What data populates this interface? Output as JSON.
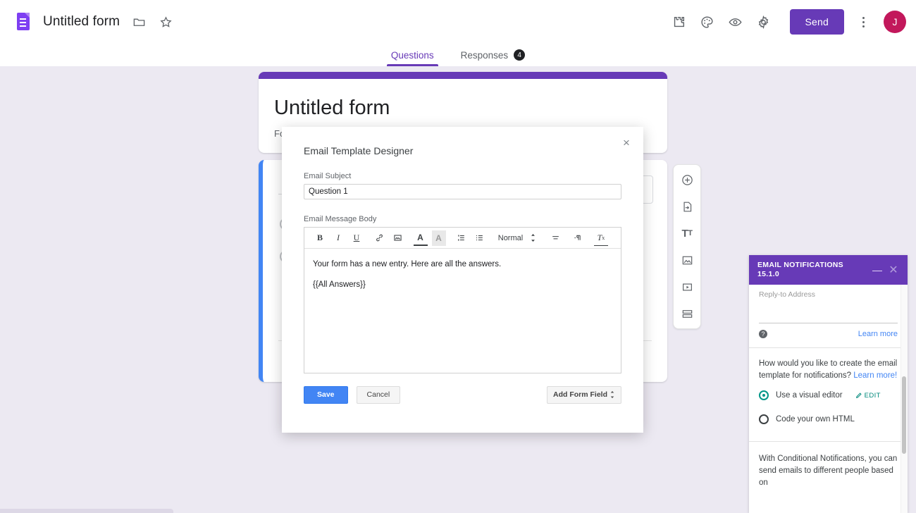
{
  "topbar": {
    "doc_title": "Untitled form",
    "icons": {
      "logo": "google-forms-logo",
      "folder": "move-to-folder-icon",
      "star": "star-icon",
      "addons": "addons-puzzle-icon",
      "theme": "theme-palette-icon",
      "preview": "preview-eye-icon",
      "settings": "settings-gear-icon",
      "more": "more-options-icon"
    },
    "send_label": "Send",
    "avatar_initial": "J"
  },
  "tabs": [
    {
      "label": "Questions",
      "active": true,
      "badge": ""
    },
    {
      "label": "Responses",
      "active": false,
      "badge": "4"
    }
  ],
  "form": {
    "title": "Untitled form",
    "description": "Form description"
  },
  "question_toolbar": [
    {
      "name": "add-question-icon",
      "tip": "Add question"
    },
    {
      "name": "import-questions-icon",
      "tip": "Import questions"
    },
    {
      "name": "add-title-description-icon",
      "tip": "Add title and description"
    },
    {
      "name": "add-image-icon",
      "tip": "Add image"
    },
    {
      "name": "add-video-icon",
      "tip": "Add video"
    },
    {
      "name": "add-section-icon",
      "tip": "Add section"
    }
  ],
  "modal": {
    "title": "Email Template Designer",
    "close_label": "×",
    "subject_label": "Email Subject",
    "subject_value": "Question 1",
    "body_label": "Email Message Body",
    "toolbar": [
      {
        "name": "bold-icon",
        "glyph": "B"
      },
      {
        "name": "italic-icon",
        "glyph": "I"
      },
      {
        "name": "underline-icon",
        "glyph": "U"
      },
      {
        "name": "link-icon",
        "glyph": "🔗"
      },
      {
        "name": "insert-image-icon",
        "glyph": "▣"
      },
      {
        "name": "text-color-icon",
        "glyph": "A"
      },
      {
        "name": "highlight-color-icon",
        "glyph": "A"
      },
      {
        "name": "ordered-list-icon",
        "glyph": "≣"
      },
      {
        "name": "bullet-list-icon",
        "glyph": "≡"
      }
    ],
    "format_select": "Normal",
    "toolbar_right": [
      {
        "name": "align-icon",
        "glyph": "≡"
      },
      {
        "name": "text-direction-icon",
        "glyph": "¶"
      },
      {
        "name": "clear-formatting-icon",
        "glyph": "T"
      }
    ],
    "body_paragraphs": [
      "Your form has a new entry. Here are all the answers.",
      "{{All Answers}}"
    ],
    "save_label": "Save",
    "cancel_label": "Cancel",
    "add_form_field_label": "Add Form Field"
  },
  "addon": {
    "title": "EMAIL NOTIFICATIONS",
    "version": "15.1.0",
    "minimize_label": "—",
    "close_label": "✕",
    "reply_to_label": "Reply-to Address",
    "reply_to_value": "",
    "help_glyph": "?",
    "learn_more_label": "Learn more",
    "question_text": "How would you like to create the email template for notifications?",
    "question_link": "Learn more!",
    "options": [
      {
        "label": "Use a visual editor",
        "selected": true,
        "edit_label": "EDIT"
      },
      {
        "label": "Code your own HTML",
        "selected": false,
        "edit_label": ""
      }
    ],
    "footer_text": "With Conditional Notifications, you can send emails to different people based on"
  },
  "colors": {
    "brand_purple": "#673ab7",
    "canvas": "#ece9f2",
    "accent_blue": "#4285f4",
    "teal": "#009688",
    "avatar": "#c2185b"
  }
}
